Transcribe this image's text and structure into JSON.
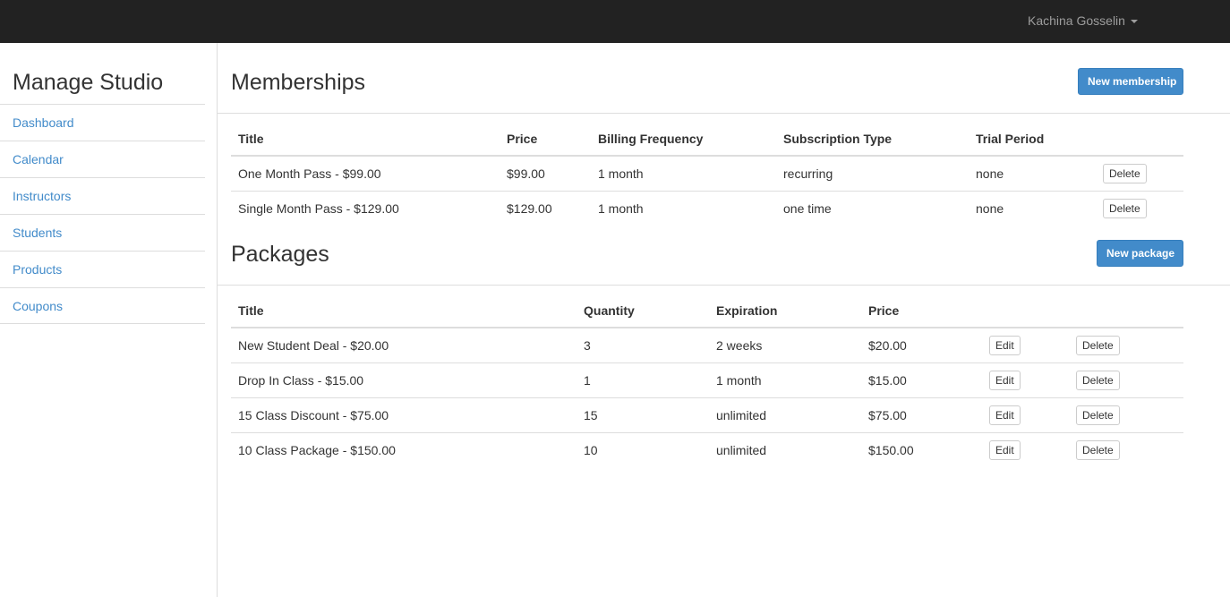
{
  "navbar": {
    "user_name": "Kachina Gosselin"
  },
  "sidebar": {
    "title": "Manage Studio",
    "items": [
      {
        "label": "Dashboard"
      },
      {
        "label": "Calendar"
      },
      {
        "label": "Instructors"
      },
      {
        "label": "Students"
      },
      {
        "label": "Products"
      },
      {
        "label": "Coupons"
      }
    ]
  },
  "memberships": {
    "title": "Memberships",
    "new_button": "New membership",
    "columns": [
      "Title",
      "Price",
      "Billing Frequency",
      "Subscription Type",
      "Trial Period",
      ""
    ],
    "rows": [
      {
        "title": "One Month Pass - $99.00",
        "price": "$99.00",
        "billing": "1 month",
        "type": "recurring",
        "trial": "none",
        "delete": "Delete"
      },
      {
        "title": "Single Month Pass - $129.00",
        "price": "$129.00",
        "billing": "1 month",
        "type": "one time",
        "trial": "none",
        "delete": "Delete"
      }
    ]
  },
  "packages": {
    "title": "Packages",
    "new_button": "New package",
    "columns": [
      "Title",
      "Quantity",
      "Expiration",
      "Price",
      "",
      ""
    ],
    "rows": [
      {
        "title": "New Student Deal - $20.00",
        "quantity": "3",
        "expiration": "2 weeks",
        "price": "$20.00",
        "edit": "Edit",
        "delete": "Delete"
      },
      {
        "title": "Drop In Class - $15.00",
        "quantity": "1",
        "expiration": "1 month",
        "price": "$15.00",
        "edit": "Edit",
        "delete": "Delete"
      },
      {
        "title": "15 Class Discount - $75.00",
        "quantity": "15",
        "expiration": "unlimited",
        "price": "$75.00",
        "edit": "Edit",
        "delete": "Delete"
      },
      {
        "title": "10 Class Package - $150.00",
        "quantity": "10",
        "expiration": "unlimited",
        "price": "$150.00",
        "edit": "Edit",
        "delete": "Delete"
      }
    ]
  }
}
